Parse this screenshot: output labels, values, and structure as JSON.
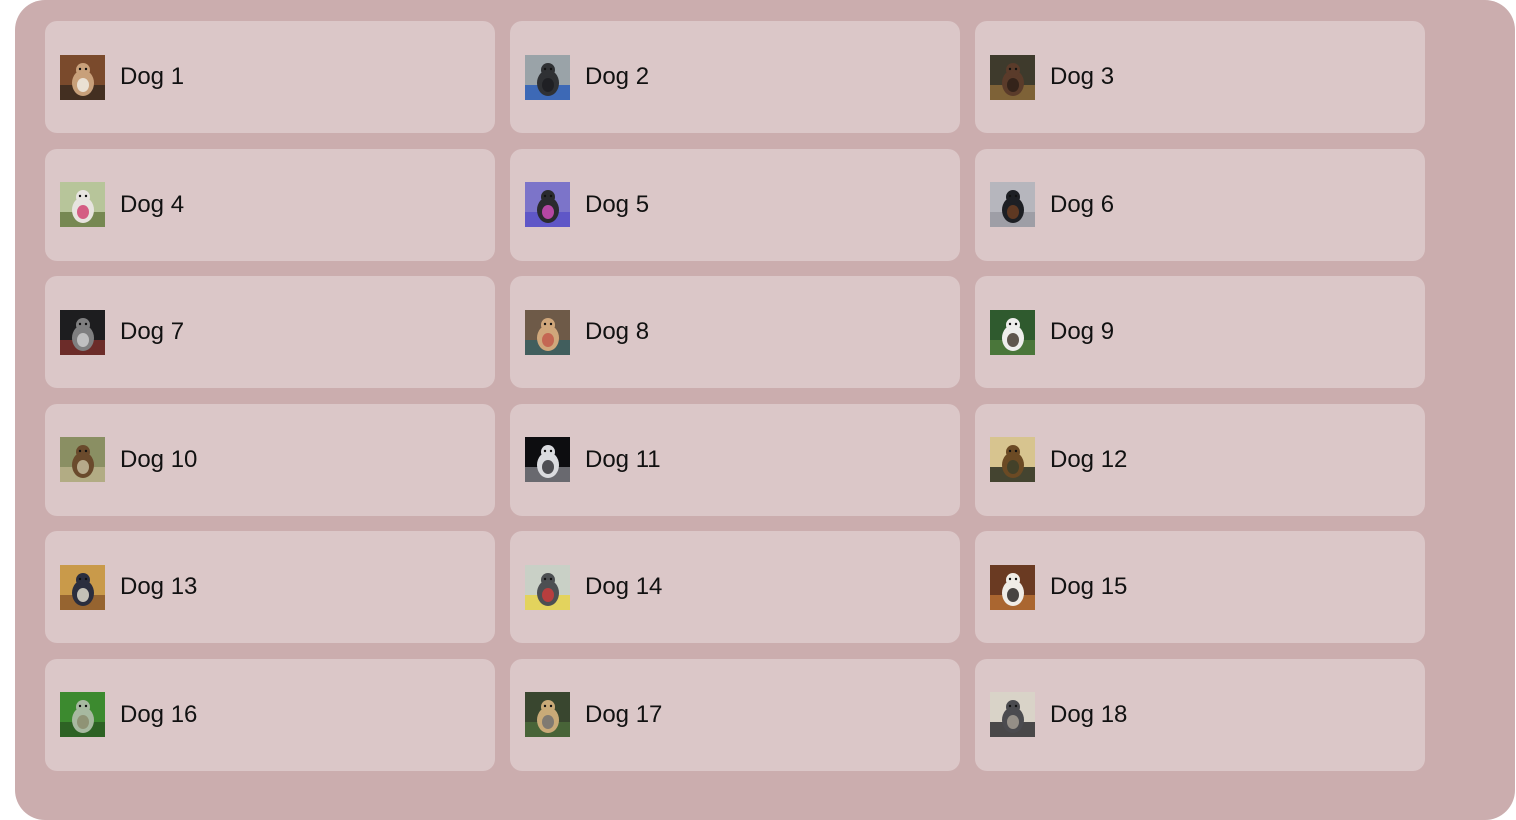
{
  "items": [
    {
      "label": "Dog 1",
      "photo": {
        "bg": "#7a4a2c",
        "mid": "#c8a07a",
        "fg": "#f2f0ea",
        "accent": "#3a2a20"
      }
    },
    {
      "label": "Dog 2",
      "photo": {
        "bg": "#9aa3a8",
        "mid": "#2f3134",
        "fg": "#1c1d20",
        "accent": "#2d5fb8"
      }
    },
    {
      "label": "Dog 3",
      "photo": {
        "bg": "#3e3a2c",
        "mid": "#5a3b2a",
        "fg": "#2a1e16",
        "accent": "#8a6a3a"
      }
    },
    {
      "label": "Dog 4",
      "photo": {
        "bg": "#b7c59a",
        "mid": "#e7e4df",
        "fg": "#cf3b6b",
        "accent": "#6b7d45"
      }
    },
    {
      "label": "Dog 5",
      "photo": {
        "bg": "#7c74c9",
        "mid": "#2a2b2e",
        "fg": "#d84fc1",
        "accent": "#5a52c7"
      }
    },
    {
      "label": "Dog 6",
      "photo": {
        "bg": "#b6b6bd",
        "mid": "#1d1f24",
        "fg": "#6f3f22",
        "accent": "#9a9aa2"
      }
    },
    {
      "label": "Dog 7",
      "photo": {
        "bg": "#1d1d1f",
        "mid": "#7f7f80",
        "fg": "#cfcfd0",
        "accent": "#7a2f2b"
      }
    },
    {
      "label": "Dog 8",
      "photo": {
        "bg": "#6e5a48",
        "mid": "#d0a77b",
        "fg": "#c0574a",
        "accent": "#3a5f62"
      }
    },
    {
      "label": "Dog 9",
      "photo": {
        "bg": "#2f5a2e",
        "mid": "#eeeeec",
        "fg": "#3a2f25",
        "accent": "#4f7b3c"
      }
    },
    {
      "label": "Dog 10",
      "photo": {
        "bg": "#8a8f63",
        "mid": "#6a4a2c",
        "fg": "#c9c1a2",
        "accent": "#b9b18a"
      }
    },
    {
      "label": "Dog 11",
      "photo": {
        "bg": "#0d0d10",
        "mid": "#dadbdf",
        "fg": "#2a2a30",
        "accent": "#7a7a80"
      }
    },
    {
      "label": "Dog 12",
      "photo": {
        "bg": "#d7c48f",
        "mid": "#6b4a24",
        "fg": "#3a3f2a",
        "accent": "#2a2e20"
      }
    },
    {
      "label": "Dog 13",
      "photo": {
        "bg": "#c99a4a",
        "mid": "#2b2e3e",
        "fg": "#ebe5d5",
        "accent": "#8d5a2b"
      }
    },
    {
      "label": "Dog 14",
      "photo": {
        "bg": "#c9d0c6",
        "mid": "#4c4f52",
        "fg": "#d23a3a",
        "accent": "#e8d44a"
      }
    },
    {
      "label": "Dog 15",
      "photo": {
        "bg": "#6a3a22",
        "mid": "#f0ece6",
        "fg": "#1e1a18",
        "accent": "#b56f32"
      }
    },
    {
      "label": "Dog 16",
      "photo": {
        "bg": "#3c8a2f",
        "mid": "#a7b9a0",
        "fg": "#8a8a6a",
        "accent": "#2a5a22"
      }
    },
    {
      "label": "Dog 17",
      "photo": {
        "bg": "#39462f",
        "mid": "#c9aa78",
        "fg": "#6e6e70",
        "accent": "#4b6a3a"
      }
    },
    {
      "label": "Dog 18",
      "photo": {
        "bg": "#d9d3c8",
        "mid": "#4b4b4f",
        "fg": "#a8a095",
        "accent": "#2f2f33"
      }
    }
  ],
  "colors": {
    "panel": "#cbadae",
    "card": "#dbc7c8",
    "text": "#111111"
  }
}
